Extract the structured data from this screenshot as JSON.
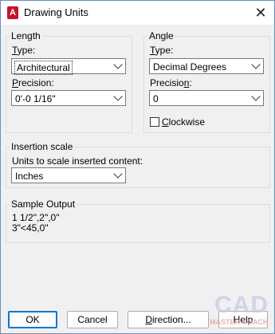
{
  "window": {
    "title": "Drawing Units",
    "app_icon_letter": "A"
  },
  "length": {
    "group_label": "Length",
    "type_label": "Type:",
    "type_value": "Architectural",
    "precision_label": "Precision:",
    "precision_value": "0'-0 1/16\""
  },
  "angle": {
    "group_label": "Angle",
    "type_label": "Type:",
    "type_value": "Decimal Degrees",
    "precision_label": "Precision:",
    "precision_value": "0",
    "clockwise_label": "Clockwise",
    "clockwise_checked": false
  },
  "insertion": {
    "group_label": "Insertion scale",
    "units_label": "Units to scale inserted content:",
    "units_value": "Inches"
  },
  "sample": {
    "group_label": "Sample Output",
    "line1": "1 1/2\",2\",0\"",
    "line2": "3\"<45,0\""
  },
  "buttons": {
    "ok": "OK",
    "cancel": "Cancel",
    "direction": "Direction...",
    "help": "Help"
  },
  "watermark": {
    "text": "CAD",
    "subtext": "MASTER COACH"
  },
  "colors": {
    "app_icon": "#c8102e",
    "default_button_border": "#0078d4"
  }
}
